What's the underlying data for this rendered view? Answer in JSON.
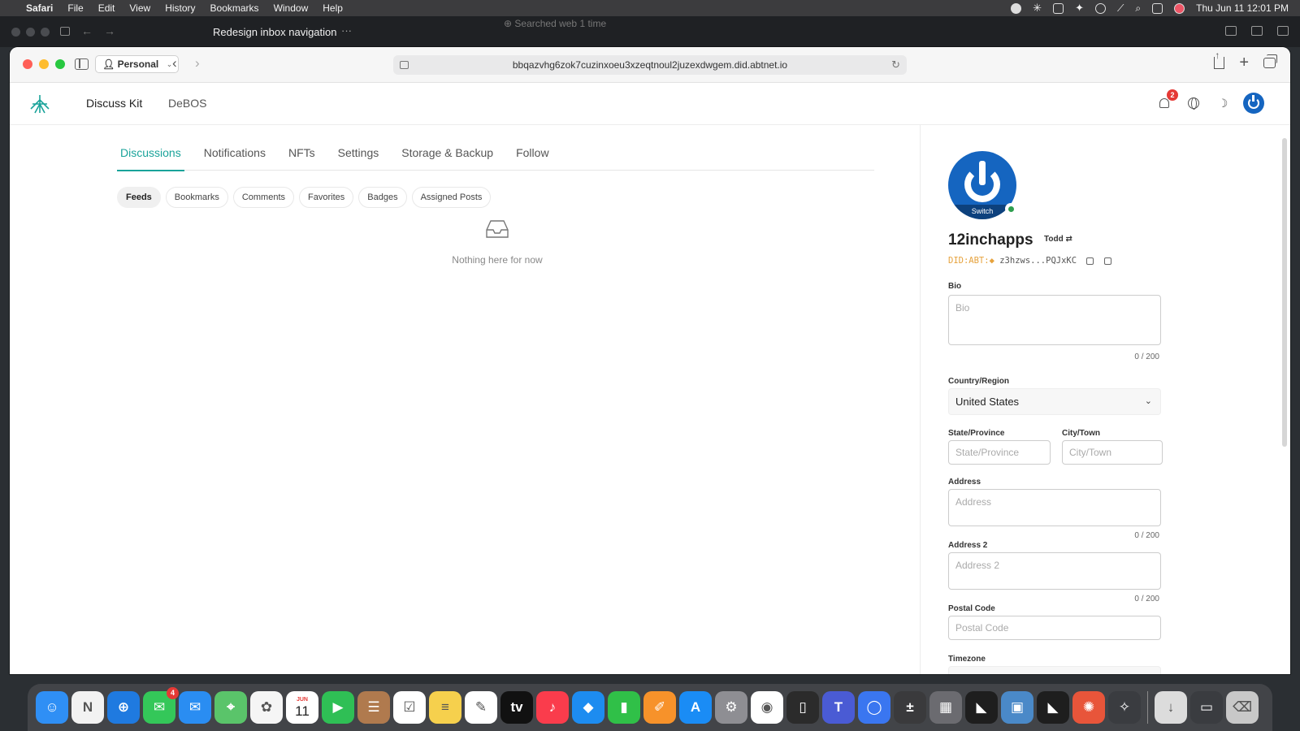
{
  "menubar": {
    "app": "Safari",
    "menus": [
      "File",
      "Edit",
      "View",
      "History",
      "Bookmarks",
      "Window",
      "Help"
    ],
    "clock": "Thu Jun 11  12:01 PM"
  },
  "background_window": {
    "title": "Redesign inbox navigation",
    "more": "···",
    "status": "⊕ Searched web 1 time"
  },
  "browser": {
    "profile": "Personal",
    "url": "bbqazvhg6zok7cuzinxoeu3xzeqtnoul2juzexdwgem.did.abtnet.io"
  },
  "site": {
    "name": "Discuss Kit",
    "link": "DeBOS",
    "notification_count": "2"
  },
  "tabs": [
    "Discussions",
    "Notifications",
    "NFTs",
    "Settings",
    "Storage & Backup",
    "Follow"
  ],
  "active_tab": "Discussions",
  "sub_tabs": [
    "Feeds",
    "Bookmarks",
    "Comments",
    "Favorites",
    "Badges",
    "Assigned Posts"
  ],
  "active_sub_tab": "Feeds",
  "empty_message": "Nothing here for now",
  "profile": {
    "switch_label": "Switch",
    "username": "12inchapps",
    "tag": "Todd",
    "did_prefix": "DID:ABT:",
    "did_value": "z3hzws...PQJxKC"
  },
  "form": {
    "bio": {
      "label": "Bio",
      "placeholder": "Bio",
      "count": "0 / 200"
    },
    "country": {
      "label": "Country/Region",
      "value": "United States"
    },
    "state": {
      "label": "State/Province",
      "placeholder": "State/Province"
    },
    "city": {
      "label": "City/Town",
      "placeholder": "City/Town"
    },
    "address": {
      "label": "Address",
      "placeholder": "Address",
      "count": "0 / 200"
    },
    "address2": {
      "label": "Address 2",
      "placeholder": "Address 2",
      "count": "0 / 200"
    },
    "postal": {
      "label": "Postal Code",
      "placeholder": "Postal Code"
    },
    "timezone": {
      "label": "Timezone"
    }
  },
  "dock": {
    "calendar_month": "JUN",
    "calendar_day": "11",
    "messages_badge": "4",
    "apps": [
      {
        "name": "finder",
        "color": "#2f8ff5"
      },
      {
        "name": "news",
        "color": "#f2f2f2"
      },
      {
        "name": "safari",
        "color": "#1f7ae0"
      },
      {
        "name": "messages",
        "color": "#34c759"
      },
      {
        "name": "mail",
        "color": "#2a8df2"
      },
      {
        "name": "maps",
        "color": "#5ac46a"
      },
      {
        "name": "photos",
        "color": "#f5f5f5"
      },
      {
        "name": "calendar",
        "color": "#ffffff"
      },
      {
        "name": "facetime",
        "color": "#2fbf55"
      },
      {
        "name": "contacts",
        "color": "#b07a4e"
      },
      {
        "name": "reminders",
        "color": "#ffffff"
      },
      {
        "name": "notes",
        "color": "#f6d04d"
      },
      {
        "name": "freeform",
        "color": "#ffffff"
      },
      {
        "name": "tv",
        "color": "#111111"
      },
      {
        "name": "music",
        "color": "#fa3c4c"
      },
      {
        "name": "keynote",
        "color": "#1d8cf0"
      },
      {
        "name": "numbers",
        "color": "#30c048"
      },
      {
        "name": "pages",
        "color": "#f7922a"
      },
      {
        "name": "app-store",
        "color": "#1a8cf5"
      },
      {
        "name": "system-settings",
        "color": "#8e8e93"
      },
      {
        "name": "chrome",
        "color": "#ffffff"
      },
      {
        "name": "iphone-mirroring",
        "color": "#2b2b2b"
      },
      {
        "name": "teams",
        "color": "#4a5bd4"
      },
      {
        "name": "signal",
        "color": "#3a76f0"
      },
      {
        "name": "calculator",
        "color": "#3a3a3c"
      },
      {
        "name": "launchpad",
        "color": "#6b6b70"
      },
      {
        "name": "cursor",
        "color": "#1e1e1e"
      },
      {
        "name": "preview",
        "color": "#4a89c8"
      },
      {
        "name": "cursor-2",
        "color": "#1e1e1e"
      },
      {
        "name": "claude",
        "color": "#e8553a"
      },
      {
        "name": "arcblock",
        "color": "#3a3c40"
      },
      {
        "name": "downloads",
        "color": "#dcdcdc"
      },
      {
        "name": "screenshot",
        "color": "#3a3c40"
      },
      {
        "name": "trash",
        "color": "#c8c8c8"
      }
    ]
  }
}
